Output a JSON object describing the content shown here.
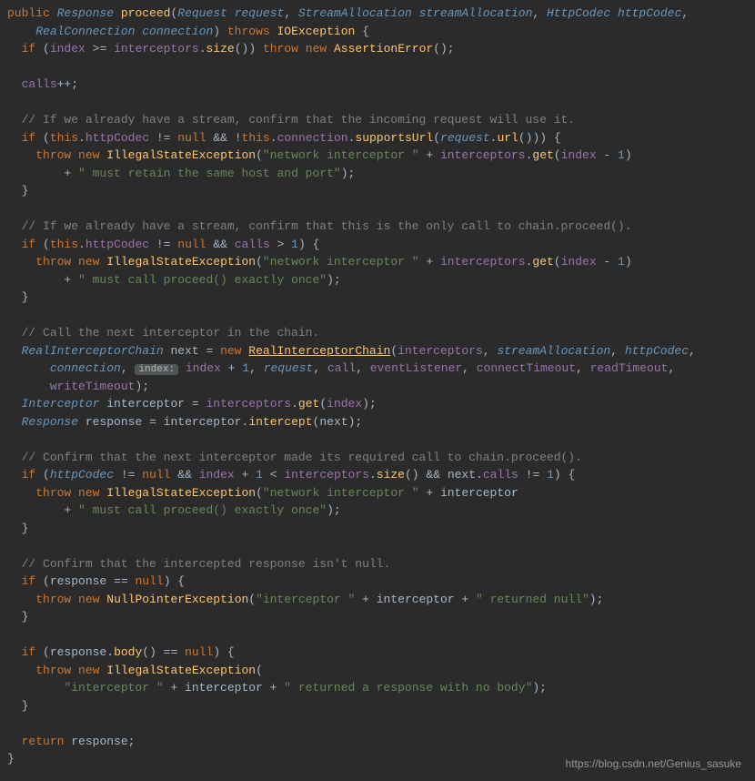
{
  "code": {
    "line1_public": "public",
    "line1_type1": "Response",
    "line1_method": "proceed",
    "line1_type2": "Request",
    "line1_param1": "request",
    "line1_type3": "StreamAllocation",
    "line1_param2": "streamAllocation",
    "line1_type4": "HttpCodec",
    "line1_param3": "httpCodec",
    "line2_type": "RealConnection",
    "line2_param": "connection",
    "line2_throws": "throws",
    "line2_exc": "IOException",
    "line3_if": "if",
    "line3_index": "index",
    "line3_interceptors": "interceptors",
    "line3_size": "size",
    "line3_throw": "throw",
    "line3_new": "new",
    "line3_exc": "AssertionError",
    "line5_calls": "calls",
    "comment1": "// If we already have a stream, confirm that the incoming request will use it.",
    "line8_if": "if",
    "line8_this": "this",
    "line8_httpCodec": "httpCodec",
    "line8_null": "null",
    "line8_connection": "connection",
    "line8_supportsUrl": "supportsUrl",
    "line8_request": "request",
    "line8_url": "url",
    "line9_throw": "throw",
    "line9_new": "new",
    "line9_exc": "IllegalStateException",
    "line9_str1": "\"network interceptor \"",
    "line9_interceptors": "interceptors",
    "line9_get": "get",
    "line9_index": "index",
    "line9_one": "1",
    "line10_str": "\" must retain the same host and port\"",
    "comment2": "// If we already have a stream, confirm that this is the only call to chain.proceed().",
    "line14_if": "if",
    "line14_this": "this",
    "line14_httpCodec": "httpCodec",
    "line14_null": "null",
    "line14_calls": "calls",
    "line14_one": "1",
    "line15_throw": "throw",
    "line15_new": "new",
    "line15_exc": "IllegalStateException",
    "line15_str1": "\"network interceptor \"",
    "line15_interceptors": "interceptors",
    "line15_get": "get",
    "line15_index": "index",
    "line15_one": "1",
    "line16_str": "\" must call proceed() exactly once\"",
    "comment3": "// Call the next interceptor in the chain.",
    "line20_type": "RealInterceptorChain",
    "line20_var": "next",
    "line20_new": "new",
    "line20_class": "RealInterceptorChain",
    "line20_interceptors": "interceptors",
    "line20_streamAllocation": "streamAllocation",
    "line20_httpCodec": "httpCodec",
    "line21_connection": "connection",
    "line21_hint": "index:",
    "line21_index": "index",
    "line21_one": "1",
    "line21_request": "request",
    "line21_call": "call",
    "line21_eventListener": "eventListener",
    "line21_connectTimeout": "connectTimeout",
    "line21_readTimeout": "readTimeout",
    "line22_writeTimeout": "writeTimeout",
    "line23_type": "Interceptor",
    "line23_var": "interceptor",
    "line23_interceptors": "interceptors",
    "line23_get": "get",
    "line23_index": "index",
    "line24_type": "Response",
    "line24_var": "response",
    "line24_interceptor": "interceptor",
    "line24_intercept": "intercept",
    "line24_next": "next",
    "comment4": "// Confirm that the next interceptor made its required call to chain.proceed().",
    "line27_if": "if",
    "line27_httpCodec": "httpCodec",
    "line27_null": "null",
    "line27_index": "index",
    "line27_one": "1",
    "line27_interceptors": "interceptors",
    "line27_size": "size",
    "line27_next": "next",
    "line27_calls": "calls",
    "line27_one2": "1",
    "line28_throw": "throw",
    "line28_new": "new",
    "line28_exc": "IllegalStateException",
    "line28_str1": "\"network interceptor \"",
    "line28_interceptor": "interceptor",
    "line29_str": "\" must call proceed() exactly once\"",
    "comment5": "// Confirm that the intercepted response isn't null.",
    "line33_if": "if",
    "line33_response": "response",
    "line33_null": "null",
    "line34_throw": "throw",
    "line34_new": "new",
    "line34_exc": "NullPointerException",
    "line34_str1": "\"interceptor \"",
    "line34_interceptor": "interceptor",
    "line34_str2": "\" returned null\"",
    "line37_if": "if",
    "line37_response": "response",
    "line37_body": "body",
    "line37_null": "null",
    "line38_throw": "throw",
    "line38_new": "new",
    "line38_exc": "IllegalStateException",
    "line39_str1": "\"interceptor \"",
    "line39_interceptor": "interceptor",
    "line39_str2": "\" returned a response with no body\"",
    "line42_return": "return",
    "line42_response": "response"
  },
  "watermark": "https://blog.csdn.net/Genius_sasuke"
}
